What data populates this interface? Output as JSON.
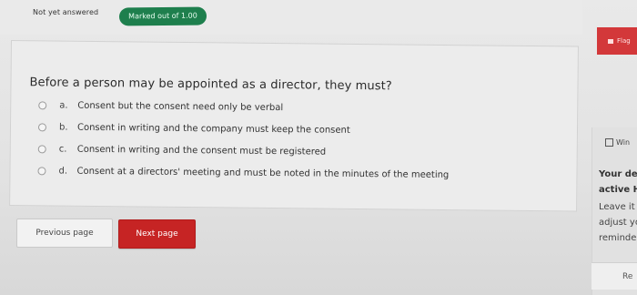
{
  "status": {
    "state": "Not yet answered",
    "marked_out_of": "Marked out of 1.00"
  },
  "flag": {
    "label": "Flag"
  },
  "question": {
    "text": "Before a person may be appointed as a director, they must?",
    "options": [
      {
        "letter": "a.",
        "text": "Consent but the consent need only be verbal"
      },
      {
        "letter": "b.",
        "text": "Consent in writing and the company must keep the consent"
      },
      {
        "letter": "c.",
        "text": "Consent in writing and the consent must be registered"
      },
      {
        "letter": "d.",
        "text": "Consent at a directors' meeting and must be noted in the minutes of the meeting"
      }
    ]
  },
  "navigation": {
    "previous_label": "Previous page",
    "next_label": "Next page"
  },
  "sidebar": {
    "window_label": "Win",
    "lines": [
      "Your de",
      "active H",
      "Leave it",
      "adjust yo",
      "reminder"
    ],
    "bottom_label": "Re"
  },
  "colors": {
    "badge": "#1e7f4d",
    "next_button": "#c62424",
    "flag_button": "#d3383a"
  }
}
